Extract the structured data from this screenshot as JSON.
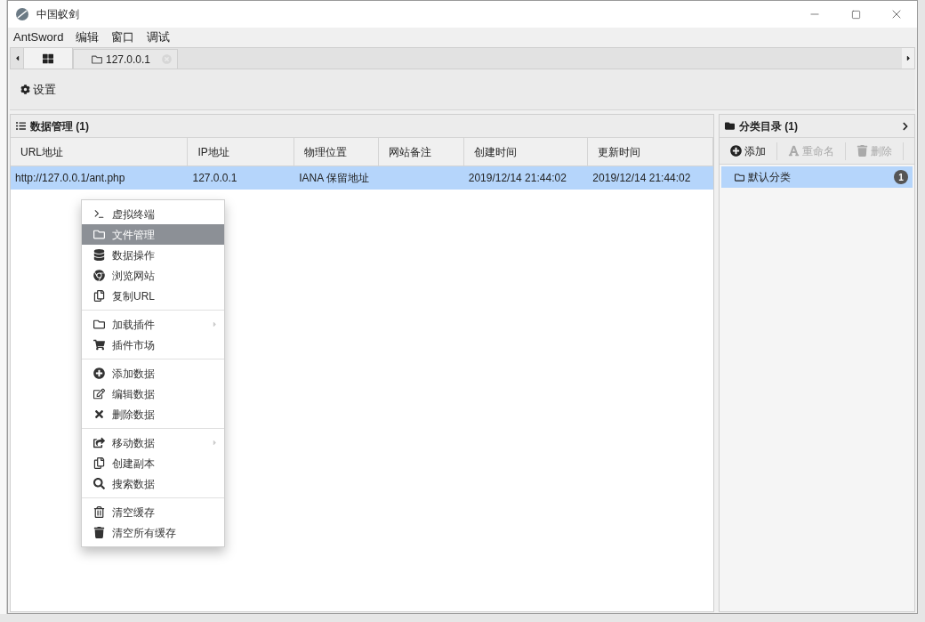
{
  "window": {
    "title": "中国蚁剑"
  },
  "menu_bar": [
    "AntSword",
    "编辑",
    "窗口",
    "调试"
  ],
  "tabs": [
    {
      "kind": "home",
      "selected": true
    },
    {
      "kind": "page",
      "label": "127.0.0.1",
      "selected": false
    }
  ],
  "toolbar": [
    {
      "label": "设置"
    }
  ],
  "data_panel": {
    "title": "数据管理 (1)",
    "columns": [
      "URL地址",
      "IP地址",
      "物理位置",
      "网站备注",
      "创建时间",
      "更新时间"
    ],
    "rows": [
      {
        "cells": [
          "http://127.0.0.1/ant.php",
          "127.0.0.1",
          "IANA 保留地址",
          "",
          "2019/12/14 21:44:02",
          "2019/12/14 21:44:02"
        ],
        "selected": true
      }
    ]
  },
  "context_menu": {
    "groups": [
      [
        {
          "kind": "terminal",
          "label": "虚拟终端",
          "highlighted": false,
          "submenu": false
        },
        {
          "kind": "folder",
          "label": "文件管理",
          "highlighted": true,
          "submenu": false
        },
        {
          "kind": "database",
          "label": "数据操作",
          "highlighted": false,
          "submenu": false
        },
        {
          "kind": "browser",
          "label": "浏览网站",
          "highlighted": false,
          "submenu": false
        },
        {
          "kind": "copy",
          "label": "复制URL",
          "highlighted": false,
          "submenu": false
        }
      ],
      [
        {
          "kind": "folder",
          "label": "加载插件",
          "highlighted": false,
          "submenu": true
        },
        {
          "kind": "cart",
          "label": "插件市场",
          "highlighted": false,
          "submenu": false
        }
      ],
      [
        {
          "kind": "plus",
          "label": "添加数据",
          "highlighted": false,
          "submenu": false
        },
        {
          "kind": "edit",
          "label": "编辑数据",
          "highlighted": false,
          "submenu": false
        },
        {
          "kind": "cross",
          "label": "删除数据",
          "highlighted": false,
          "submenu": false
        }
      ],
      [
        {
          "kind": "share",
          "label": "移动数据",
          "highlighted": false,
          "submenu": true
        },
        {
          "kind": "copy",
          "label": "创建副本",
          "highlighted": false,
          "submenu": false
        },
        {
          "kind": "search",
          "label": "搜索数据",
          "highlighted": false,
          "submenu": false
        }
      ],
      [
        {
          "kind": "trash-outline",
          "label": "清空缓存",
          "highlighted": false,
          "submenu": false
        },
        {
          "kind": "trash",
          "label": "清空所有缓存",
          "highlighted": false,
          "submenu": false
        }
      ]
    ]
  },
  "category_panel": {
    "title": "分类目录 (1)",
    "actions": [
      {
        "kind": "plus",
        "label": "添加",
        "disabled": false
      },
      {
        "kind": "font",
        "label": "重命名",
        "disabled": true
      },
      {
        "kind": "trash",
        "label": "删除",
        "disabled": true
      }
    ],
    "items": [
      {
        "label": "默认分类",
        "count": "1",
        "selected": true
      }
    ]
  }
}
